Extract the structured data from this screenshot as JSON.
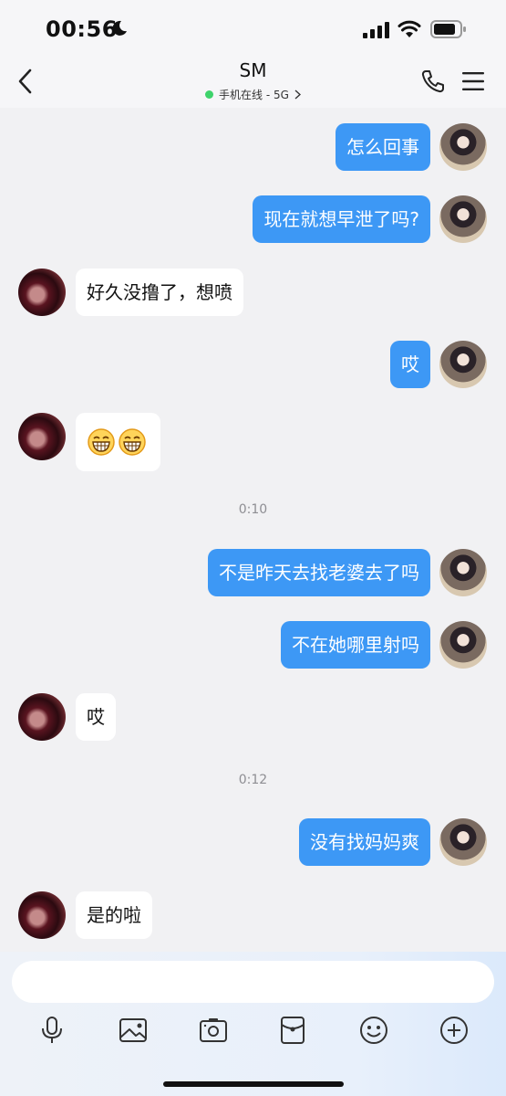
{
  "status_bar": {
    "time": "00:56",
    "moon_icon": "moon-icon",
    "signal_icon": "cellular-signal-icon",
    "wifi_icon": "wifi-icon",
    "battery_icon": "battery-icon"
  },
  "header": {
    "title": "SM",
    "status": "手机在线 - 5G",
    "online_color": "#3ed36b"
  },
  "messages": [
    {
      "from": "me",
      "text": "怎么回事"
    },
    {
      "from": "me",
      "text": "现在就想早泄了吗?"
    },
    {
      "from": "other",
      "text": "好久没撸了，想喷"
    },
    {
      "from": "me",
      "text": "哎"
    },
    {
      "from": "other",
      "emoji": [
        "grinning-face-emoji",
        "grinning-face-emoji"
      ]
    },
    {
      "timestamp": "0:10"
    },
    {
      "from": "me",
      "text": "不是昨天去找老婆去了吗"
    },
    {
      "from": "me",
      "text": "不在她哪里射吗"
    },
    {
      "from": "other",
      "text": "哎"
    },
    {
      "timestamp": "0:12"
    },
    {
      "from": "me",
      "text": "没有找妈妈爽"
    },
    {
      "from": "other",
      "text": "是的啦"
    }
  ],
  "input": {
    "value": ""
  },
  "toolbar": [
    "microphone-icon",
    "image-icon",
    "camera-icon",
    "red-envelope-icon",
    "emoji-icon",
    "plus-icon"
  ],
  "colors": {
    "outgoing_bubble": "#3d98f5",
    "incoming_bubble": "#ffffff",
    "background": "#f1f1f3"
  }
}
